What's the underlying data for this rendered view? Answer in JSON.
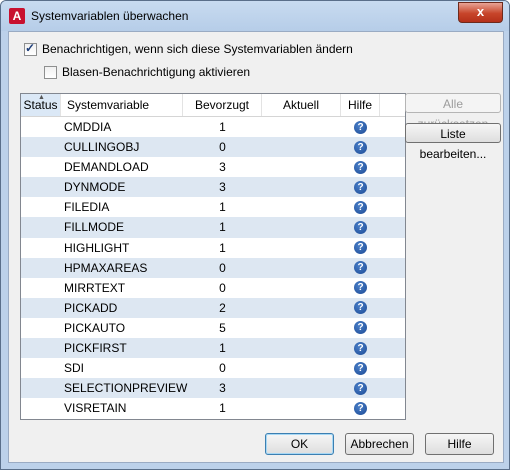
{
  "window": {
    "title": "Systemvariablen überwachen",
    "close_label": "x",
    "app_icon_letter": "A"
  },
  "options": {
    "notify_label": "Benachrichtigen, wenn sich diese Systemvariablen ändern",
    "notify_checked": true,
    "balloon_label": "Blasen-Benachrichtigung aktivieren",
    "balloon_checked": false
  },
  "table": {
    "columns": [
      "Status",
      "Systemvariable",
      "Bevorzugt",
      "Aktuell",
      "Hilfe"
    ],
    "rows": [
      {
        "name": "CMDDIA",
        "preferred": "1"
      },
      {
        "name": "CULLINGOBJ",
        "preferred": "0"
      },
      {
        "name": "DEMANDLOAD",
        "preferred": "3"
      },
      {
        "name": "DYNMODE",
        "preferred": "3"
      },
      {
        "name": "FILEDIA",
        "preferred": "1"
      },
      {
        "name": "FILLMODE",
        "preferred": "1"
      },
      {
        "name": "HIGHLIGHT",
        "preferred": "1"
      },
      {
        "name": "HPMAXAREAS",
        "preferred": "0"
      },
      {
        "name": "MIRRTEXT",
        "preferred": "0"
      },
      {
        "name": "PICKADD",
        "preferred": "2"
      },
      {
        "name": "PICKAUTO",
        "preferred": "5"
      },
      {
        "name": "PICKFIRST",
        "preferred": "1"
      },
      {
        "name": "SDI",
        "preferred": "0"
      },
      {
        "name": "SELECTIONPREVIEW",
        "preferred": "3"
      },
      {
        "name": "VISRETAIN",
        "preferred": "1"
      }
    ]
  },
  "side_buttons": {
    "reset_all": "Alle zurücksetzen",
    "edit_list": "Liste bearbeiten..."
  },
  "footer": {
    "ok": "OK",
    "cancel": "Abbrechen",
    "help": "Hilfe"
  },
  "colors": {
    "row_alt": "#dde7f2",
    "title_bg": "#bcd1ea",
    "close_btn": "#c7452a"
  },
  "icons": {
    "help": "question-circle-icon",
    "app": "autocad-logo-icon"
  }
}
